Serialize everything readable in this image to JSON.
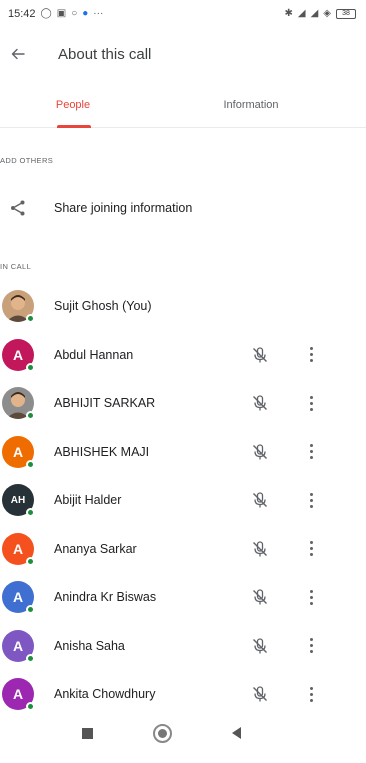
{
  "status_bar": {
    "time": "15:42",
    "left_icons": [
      "shield-icon",
      "gallery-icon",
      "alarm-icon",
      "chrome-icon",
      "more-dots-icon"
    ],
    "battery": "38",
    "right_icons": [
      "bluetooth-icon",
      "signal-icon",
      "signal-icon",
      "wifi-icon",
      "battery-icon"
    ]
  },
  "header": {
    "title": "About this call"
  },
  "tabs": [
    {
      "label": "People",
      "active": true
    },
    {
      "label": "Information",
      "active": false
    }
  ],
  "sections": {
    "add_others": "ADD OTHERS",
    "share_label": "Share joining information",
    "in_call": "IN CALL"
  },
  "colors": {
    "accent": "#e8453c",
    "online": "#1e8e3e"
  },
  "people": [
    {
      "name": "Sujit Ghosh (You)",
      "avatar_type": "photo",
      "avatar_color": "#c8a07a",
      "initials": "",
      "show_controls": false
    },
    {
      "name": "Abdul Hannan",
      "avatar_type": "initial",
      "avatar_color": "#c2185b",
      "initials": "A",
      "show_controls": true
    },
    {
      "name": "ABHIJIT SARKAR",
      "avatar_type": "photo",
      "avatar_color": "#8d8d8d",
      "initials": "",
      "show_controls": true
    },
    {
      "name": "ABHISHEK MAJI",
      "avatar_type": "initial",
      "avatar_color": "#ef6c00",
      "initials": "A",
      "show_controls": true
    },
    {
      "name": "Abijit Halder",
      "avatar_type": "initial",
      "avatar_color": "#263238",
      "initials": "AH",
      "show_controls": true
    },
    {
      "name": "Ananya Sarkar",
      "avatar_type": "initial",
      "avatar_color": "#f4511e",
      "initials": "A",
      "show_controls": true
    },
    {
      "name": "Anindra Kr Biswas",
      "avatar_type": "initial",
      "avatar_color": "#3f6fd1",
      "initials": "A",
      "show_controls": true
    },
    {
      "name": "Anisha Saha",
      "avatar_type": "initial",
      "avatar_color": "#7e57c2",
      "initials": "A",
      "show_controls": true
    },
    {
      "name": "Ankita Chowdhury",
      "avatar_type": "initial",
      "avatar_color": "#9c27b0",
      "initials": "A",
      "show_controls": true
    }
  ]
}
